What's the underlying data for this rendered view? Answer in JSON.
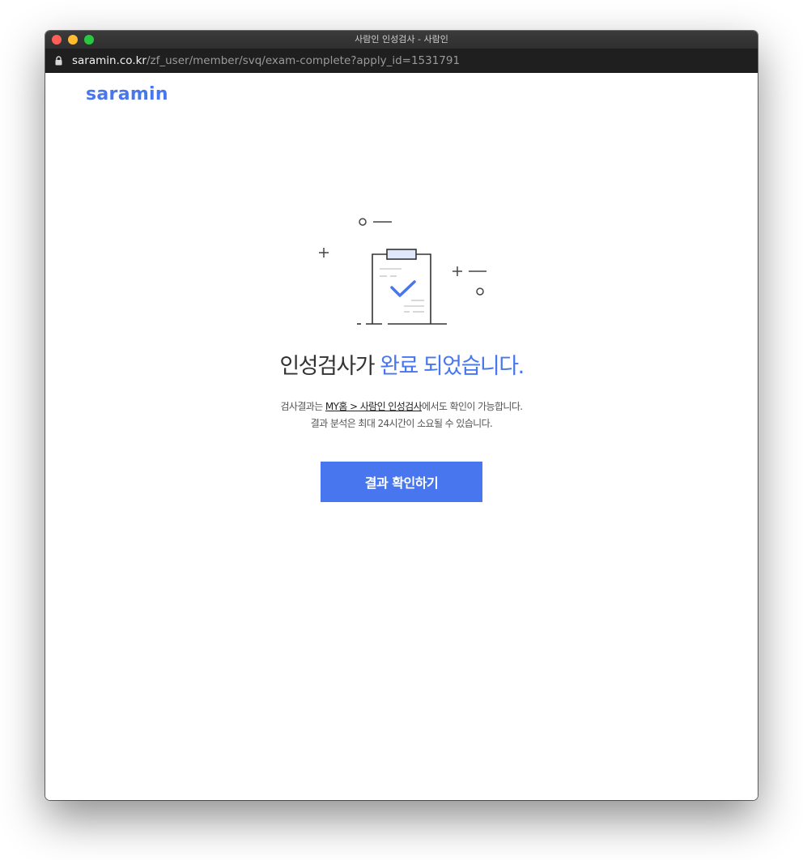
{
  "window": {
    "title": "사람인 인성검사 - 사람인"
  },
  "address_bar": {
    "host": "saramin.co.kr",
    "path": "/zf_user/member/svq/exam-complete?apply_id=1531791"
  },
  "header": {
    "logo_text": "saramin"
  },
  "main": {
    "headline_prefix": "인성검사가",
    "headline_accent": "완료 되었습니다.",
    "description_line1_before": "검사결과는 ",
    "description_link": "MY홈 > 사람인 인성검사",
    "description_line1_after": "에서도 확인이 가능합니다.",
    "description_line2": "결과 분석은 최대 24시간이 소요될 수 있습니다.",
    "button_label": "결과 확인하기"
  },
  "colors": {
    "accent": "#4876ef",
    "text": "#333333",
    "titlebar": "#3b3b3b",
    "addressbar": "#1f1f1f"
  },
  "icons": [
    "lock-icon",
    "clipboard-check-icon"
  ]
}
